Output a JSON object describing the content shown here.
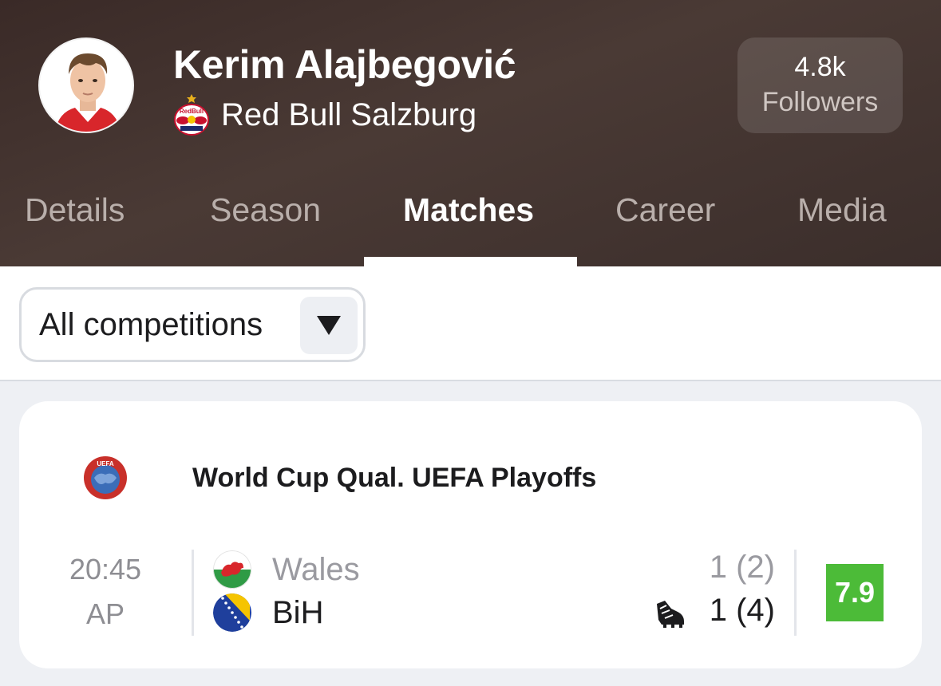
{
  "player": {
    "name": "Kerim Alajbegović",
    "club": "Red Bull Salzburg",
    "club_logo_icon": "red-bull-salzburg-crest-icon"
  },
  "followers": {
    "count": "4.8k",
    "label": "Followers"
  },
  "tabs": [
    {
      "label": "Details",
      "active": false
    },
    {
      "label": "Season",
      "active": false
    },
    {
      "label": "Matches",
      "active": true
    },
    {
      "label": "Career",
      "active": false
    },
    {
      "label": "Media",
      "active": false
    }
  ],
  "filter": {
    "selected": "All competitions",
    "dropdown_icon": "triangle-down-icon"
  },
  "match": {
    "competition": "World Cup Qual. UEFA Playoffs",
    "competition_icon": "uefa-logo-icon",
    "time": "20:45",
    "status": "AP",
    "home": {
      "team": "Wales",
      "score": "1 (2)",
      "flag_icon": "wales-flag-icon"
    },
    "away": {
      "team": "BiH",
      "score": "1 (4)",
      "flag_icon": "bosnia-flag-icon"
    },
    "scorer_icon": "football-boot-icon",
    "rating": "7.9",
    "rating_color": "#4cbb38"
  },
  "colors": {
    "header_bg": "#3f302c",
    "active_tab": "#ffffff",
    "inactive_tab": "#b9afab",
    "page_bg": "#eef0f4"
  }
}
